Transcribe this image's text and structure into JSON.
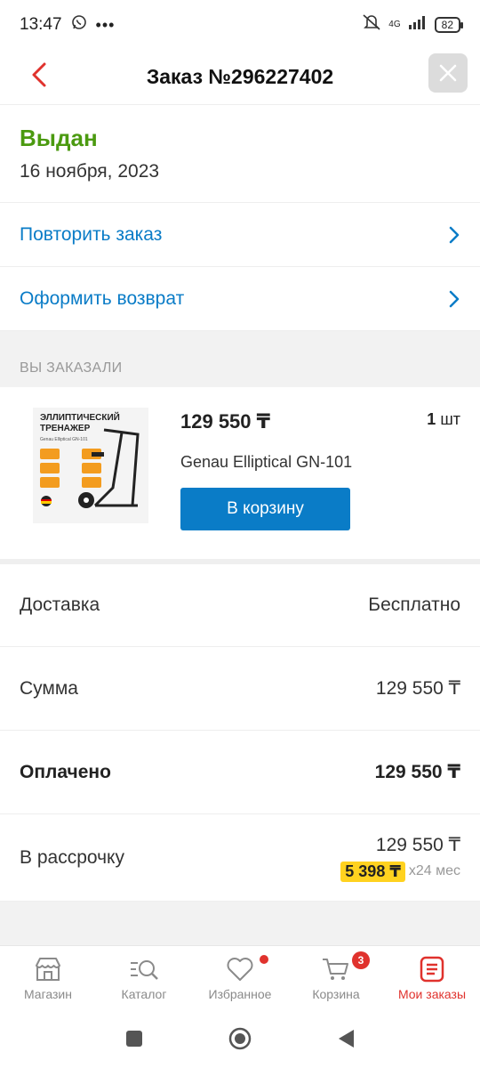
{
  "status_bar": {
    "time": "13:47",
    "network": "4G",
    "battery": "82"
  },
  "header": {
    "title": "Заказ №296227402"
  },
  "order": {
    "status": "Выдан",
    "date": "16 ноября, 2023",
    "status_color": "#4b9a10"
  },
  "actions": [
    {
      "label": "Повторить заказ"
    },
    {
      "label": "Оформить возврат"
    }
  ],
  "section_title": "ВЫ ЗАКАЗАЛИ",
  "product": {
    "price": "129 550 ₸",
    "qty_value": "1",
    "qty_unit": "шт",
    "name": "Genau Elliptical GN-101",
    "cart_label": "В корзину",
    "image_title_line1": "ЭЛЛИПТИЧЕСКИЙ",
    "image_title_line2": "ТРЕНАЖЕР",
    "image_subtitle": "Genau Elliptical GN-101"
  },
  "summary": {
    "delivery_label": "Доставка",
    "delivery_value": "Бесплатно",
    "sum_label": "Сумма",
    "sum_value": "129 550 ₸",
    "paid_label": "Оплачено",
    "paid_value": "129 550 ₸",
    "installment_label": "В рассрочку",
    "installment_total": "129 550 ₸",
    "installment_monthly": "5 398 ₸",
    "installment_months": "x24 мес"
  },
  "tabs": [
    {
      "label": "Магазин",
      "icon": "store-icon"
    },
    {
      "label": "Каталог",
      "icon": "catalog-search-icon"
    },
    {
      "label": "Избранное",
      "icon": "heart-icon"
    },
    {
      "label": "Корзина",
      "icon": "cart-icon",
      "badge": "3"
    },
    {
      "label": "Мои заказы",
      "icon": "orders-icon",
      "active": true
    }
  ],
  "colors": {
    "accent_blue": "#0a7cc7",
    "accent_red": "#e0322d",
    "success_green": "#4b9a10",
    "installment_yellow": "#ffd21f"
  }
}
